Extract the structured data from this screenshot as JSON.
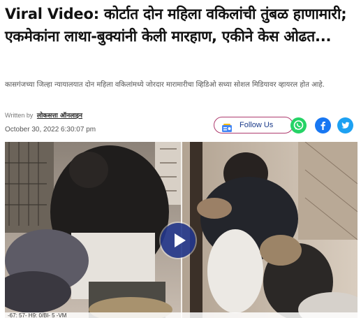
{
  "article": {
    "headline": "Viral Video: कोर्टात दोन महिला वकिलांची तुंबळ हाणामारी; एकमेकांना लाथा-बुक्यांनी केली मारहाण, एकीने केस ओढत...",
    "summary": "कासगंजच्या जिल्हा न्यायालयात दोन महिला वकिलांमध्ये जोरदार मारामारीचा व्हिडिओ सध्या सोशल मिडियावर व्हायरल होत आहे.",
    "written_by_label": "Written by",
    "author": "लोकसत्ता ऑनलाइन",
    "date": "October 30, 2022 6:30:07 pm"
  },
  "follow": {
    "label": "Follow Us",
    "icon": "google-news-icon"
  },
  "share": [
    {
      "name": "whatsapp-icon",
      "color": "#25d366"
    },
    {
      "name": "facebook-icon",
      "color": "#1877f2"
    },
    {
      "name": "twitter-icon",
      "color": "#1da1f2"
    }
  ],
  "video": {
    "play_icon": "play-icon",
    "ticker": "-67: 57- H9: 0/Bl- 5 -VM"
  },
  "colors": {
    "follow_border": "#ae3b6e",
    "follow_text": "#1a3a8a",
    "play_button": "#23378c"
  }
}
